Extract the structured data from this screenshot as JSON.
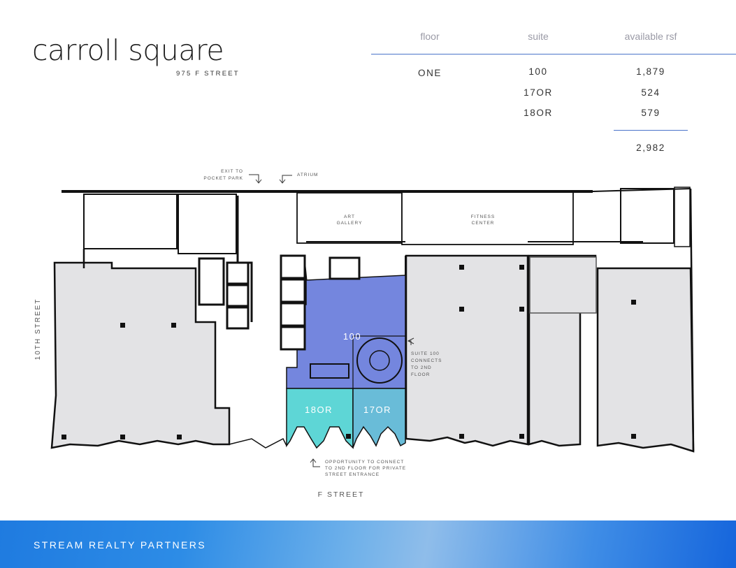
{
  "brand": {
    "name": "carroll square",
    "address": "975 F STREET"
  },
  "table": {
    "headers": {
      "floor": "floor",
      "suite": "suite",
      "rsf": "available rsf"
    },
    "rows": [
      {
        "floor": "ONE",
        "suite": "100",
        "rsf": "1,879"
      },
      {
        "floor": "",
        "suite": "17OR",
        "rsf": "524"
      },
      {
        "floor": "",
        "suite": "18OR",
        "rsf": "579"
      }
    ],
    "total": "2,982"
  },
  "plan": {
    "exit_label_1": "EXIT TO",
    "exit_label_2": "POCKET PARK",
    "atrium_label": "ATRIUM",
    "art_gallery_1": "ART",
    "art_gallery_2": "GALLERY",
    "fitness_1": "FITNESS",
    "fitness_2": "CENTER",
    "street_left": "10TH STREET",
    "street_bottom": "F STREET",
    "suite_100": "100",
    "suite_180r": "18OR",
    "suite_170r": "17OR",
    "note_connect_1": "SUITE 100",
    "note_connect_2": "CONNECTS",
    "note_connect_3": "TO 2ND",
    "note_connect_4": "FLOOR",
    "note_opp_1": "OPPORTUNITY TO CONNECT",
    "note_opp_2": "TO 2ND FLOOR FOR PRIVATE",
    "note_opp_3": "STREET ENTRANCE",
    "colors": {
      "suite_100": "#7486de",
      "suite_180r": "#5ed6d6",
      "suite_170r": "#69bcd8",
      "space": "#e3e3e5",
      "wall": "#111111"
    }
  },
  "footer": {
    "company": "STREAM REALTY PARTNERS"
  }
}
